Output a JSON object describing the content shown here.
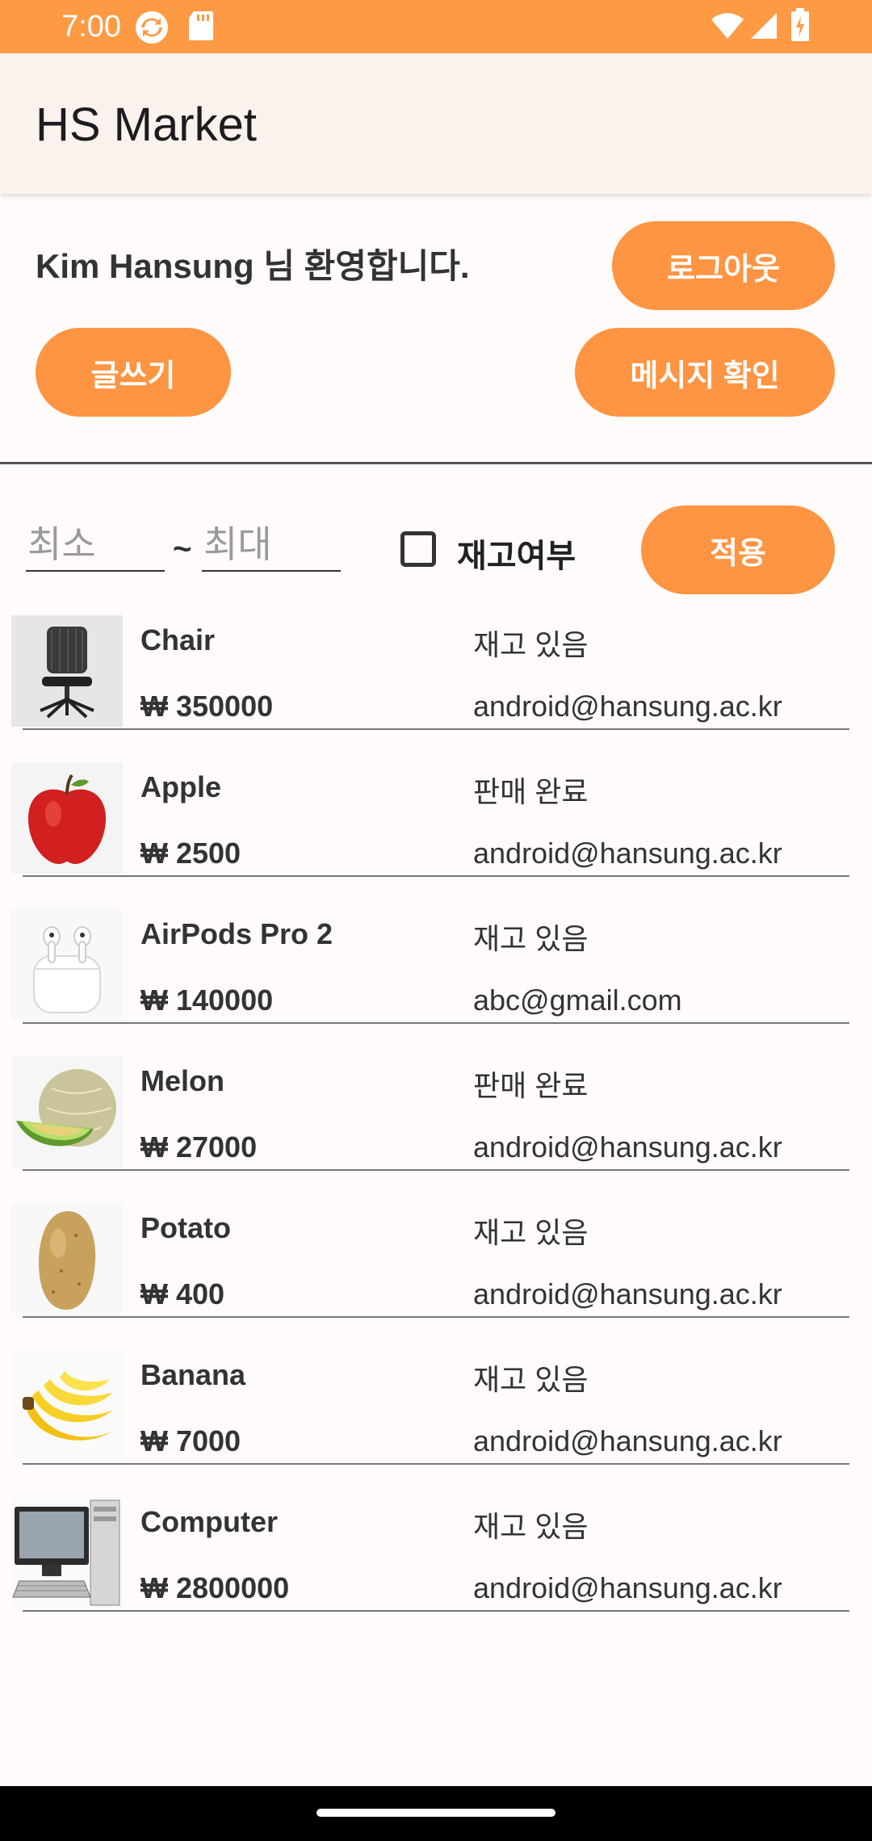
{
  "status_bar": {
    "time": "7:00"
  },
  "app_bar": {
    "title": "HS Market"
  },
  "header": {
    "welcome": "Kim Hansung 님 환영합니다.",
    "logout_label": "로그아웃",
    "write_label": "글쓰기",
    "messages_label": "메시지 확인"
  },
  "filter": {
    "min_placeholder": "최소",
    "separator": "~",
    "max_placeholder": "최대",
    "stock_label": "재고여부",
    "stock_checked": false,
    "apply_label": "적용"
  },
  "products": [
    {
      "name": "Chair",
      "price": "₩ 350000",
      "status": "재고 있음",
      "email": "android@hansung.ac.kr",
      "icon": "chair-image"
    },
    {
      "name": "Apple",
      "price": "₩ 2500",
      "status": "판매 완료",
      "email": "android@hansung.ac.kr",
      "icon": "apple-image"
    },
    {
      "name": "AirPods Pro 2",
      "price": "₩ 140000",
      "status": "재고 있음",
      "email": "abc@gmail.com",
      "icon": "airpods-image"
    },
    {
      "name": "Melon",
      "price": "₩ 27000",
      "status": "판매 완료",
      "email": "android@hansung.ac.kr",
      "icon": "melon-image"
    },
    {
      "name": "Potato",
      "price": "₩ 400",
      "status": "재고 있음",
      "email": "android@hansung.ac.kr",
      "icon": "potato-image"
    },
    {
      "name": "Banana",
      "price": "₩ 7000",
      "status": "재고 있음",
      "email": "android@hansung.ac.kr",
      "icon": "banana-image"
    },
    {
      "name": "Computer",
      "price": "₩ 2800000",
      "status": "재고 있음",
      "email": "android@hansung.ac.kr",
      "icon": "computer-image"
    }
  ],
  "colors": {
    "accent": "#ff9442",
    "status_bar": "#ff9a44",
    "app_bar": "#fcf2ed",
    "background": "#fffbfa"
  }
}
